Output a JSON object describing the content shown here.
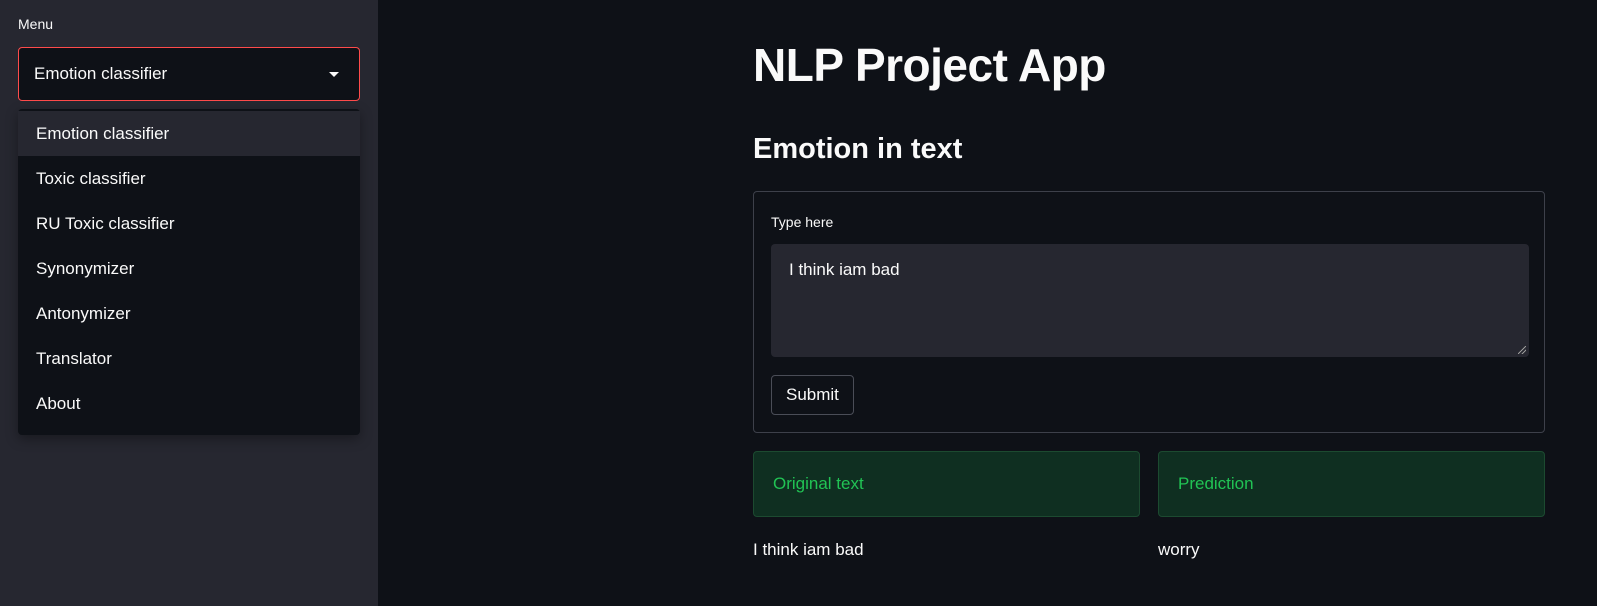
{
  "sidebar": {
    "menu_label": "Menu",
    "select": {
      "value": "Emotion classifier",
      "options": [
        "Emotion classifier",
        "Toxic classifier",
        "RU Toxic classifier",
        "Synonymizer",
        "Antonymizer",
        "Translator",
        "About"
      ]
    }
  },
  "main": {
    "title": "NLP Project App",
    "subheader": "Emotion in text",
    "form": {
      "label": "Type here",
      "text_value": "I think iam bad",
      "submit_label": "Submit"
    },
    "results": {
      "left_header": "Original text",
      "right_header": "Prediction",
      "left_value": "I think iam bad",
      "right_value": "worry"
    }
  },
  "colors": {
    "accent": "#ff4b4b",
    "background": "#0e1117",
    "sidebar_bg": "#262730",
    "success_text": "#21c354",
    "success_bg": "#0f2f21"
  }
}
